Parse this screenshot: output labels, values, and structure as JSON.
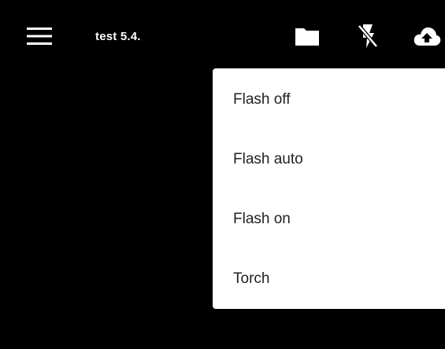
{
  "app_bar": {
    "title": "test 5.4.",
    "menu_icon": "hamburger-menu-icon",
    "actions": [
      {
        "icon": "folder-icon"
      },
      {
        "icon": "flash-off-icon"
      },
      {
        "icon": "cloud-upload-icon"
      }
    ]
  },
  "flash_menu": {
    "items": [
      {
        "label": "Flash off"
      },
      {
        "label": "Flash auto"
      },
      {
        "label": "Flash on"
      },
      {
        "label": "Torch"
      }
    ]
  },
  "colors": {
    "background": "#000000",
    "app_bar": "#000000",
    "menu_surface": "#ffffff",
    "menu_text": "#212121",
    "icon": "#ffffff"
  }
}
